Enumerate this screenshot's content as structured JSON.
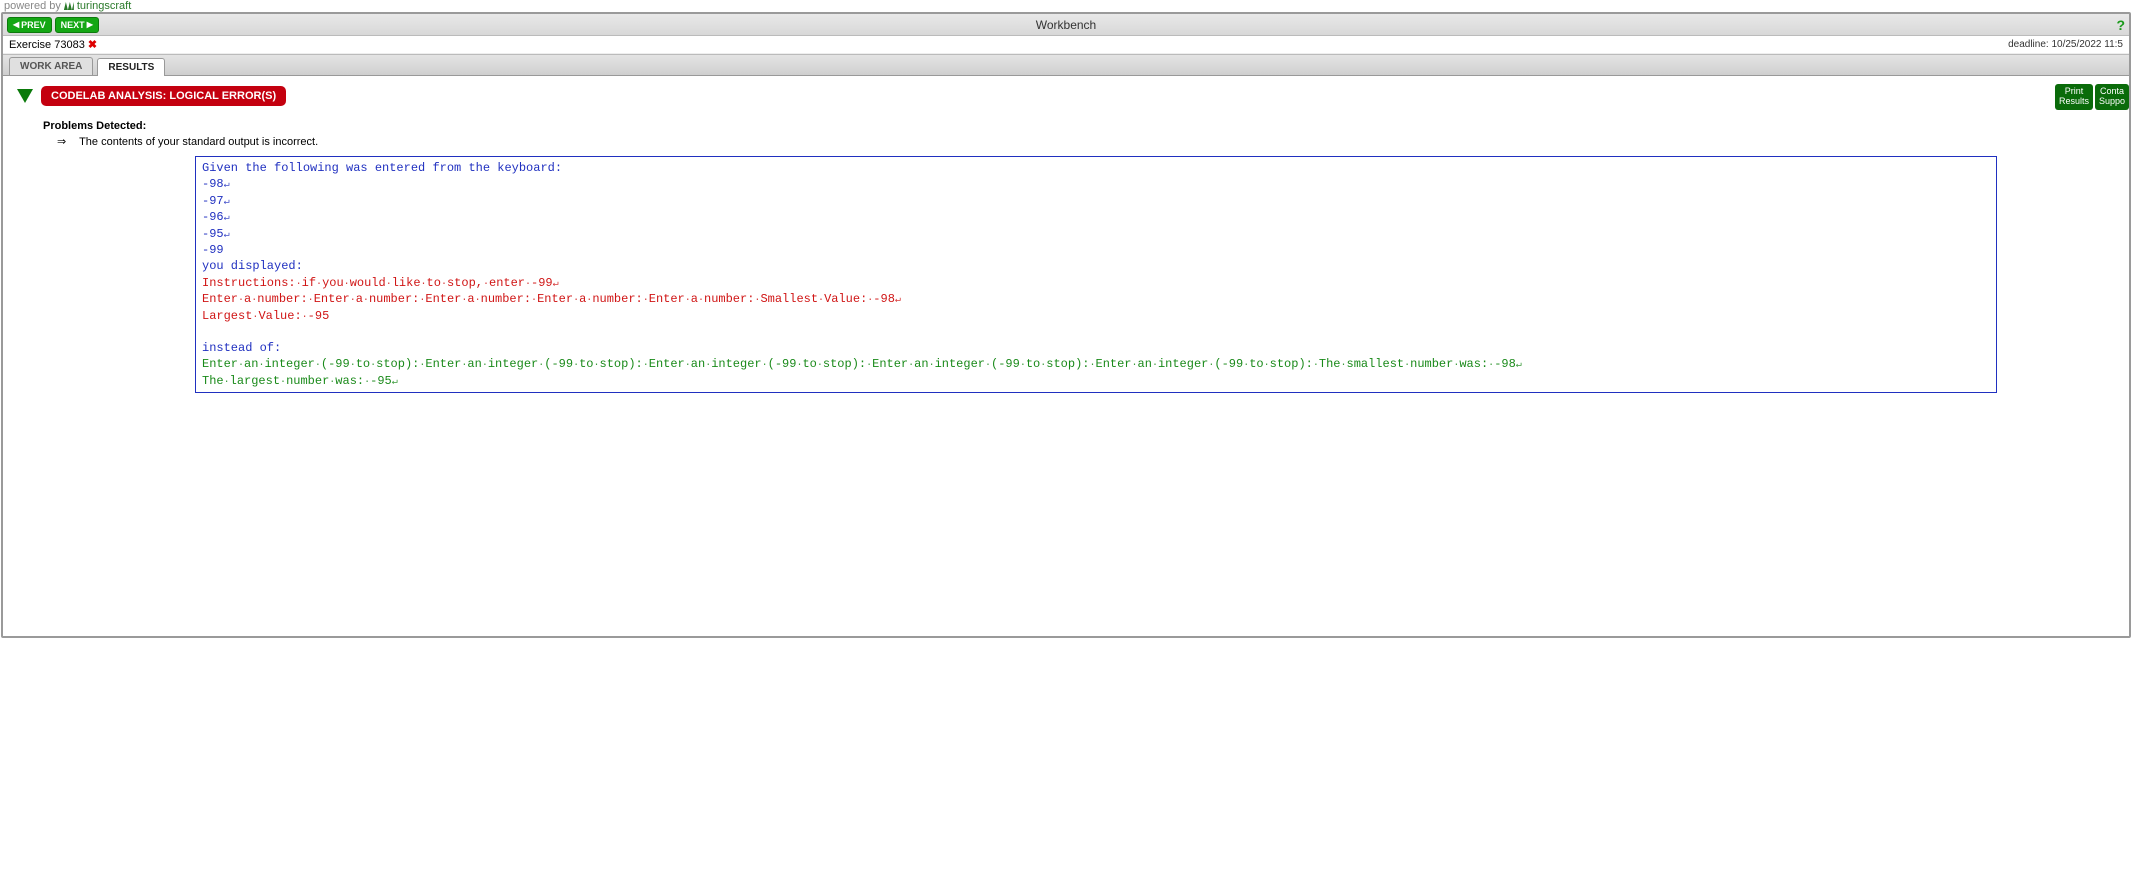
{
  "poweredByPrefix": "powered by",
  "brand": "turingscraft",
  "topbar": {
    "prev": "PREV",
    "next": "NEXT",
    "title": "Workbench"
  },
  "exercise": {
    "label": "Exercise 73083",
    "deadline": "deadline: 10/25/2022 11:5"
  },
  "tabs": {
    "workArea": "WORK AREA",
    "results": "RESULTS"
  },
  "analysisBadge": "CODELAB ANALYSIS: LOGICAL ERROR(S)",
  "buttons": {
    "printLine1": "Print",
    "printLine2": "Results",
    "contactLine1": "Conta",
    "contactLine2": "Suppo"
  },
  "problems": {
    "title": "Problems Detected:",
    "item": "The contents of your standard output is incorrect."
  },
  "symbols": {
    "newline": "↵",
    "space": "·"
  },
  "output": {
    "givenHeader": "Given the following was entered from the keyboard:",
    "inputs": [
      "-98",
      "-97",
      "-96",
      "-95",
      "-99"
    ],
    "displayedHeader": "you displayed:",
    "actual": {
      "line1Parts": [
        "Instructions:",
        "if",
        "you",
        "would",
        "like",
        "to",
        "stop,",
        "enter",
        "-99"
      ],
      "line2Prefix": "Enter",
      "line2RepeatA": "a",
      "line2RepeatB": "number:",
      "line2SmallestA": "Smallest",
      "line2SmallestB": "Value:",
      "line2SmallestC": "-98",
      "line3A": "Largest",
      "line3B": "Value:",
      "line3C": "-95"
    },
    "insteadHeader": "instead of:",
    "expected": {
      "promptA": "Enter",
      "promptB": "an",
      "promptC": "integer",
      "promptD": "(-99",
      "promptE": "to",
      "promptF": "stop):",
      "smallA": "The",
      "smallB": "smallest",
      "smallC": "number",
      "smallD": "was:",
      "smallE": "-98",
      "largeA": "The",
      "largeB": "largest",
      "largeC": "number",
      "largeD": "was:",
      "largeE": "-95"
    }
  }
}
